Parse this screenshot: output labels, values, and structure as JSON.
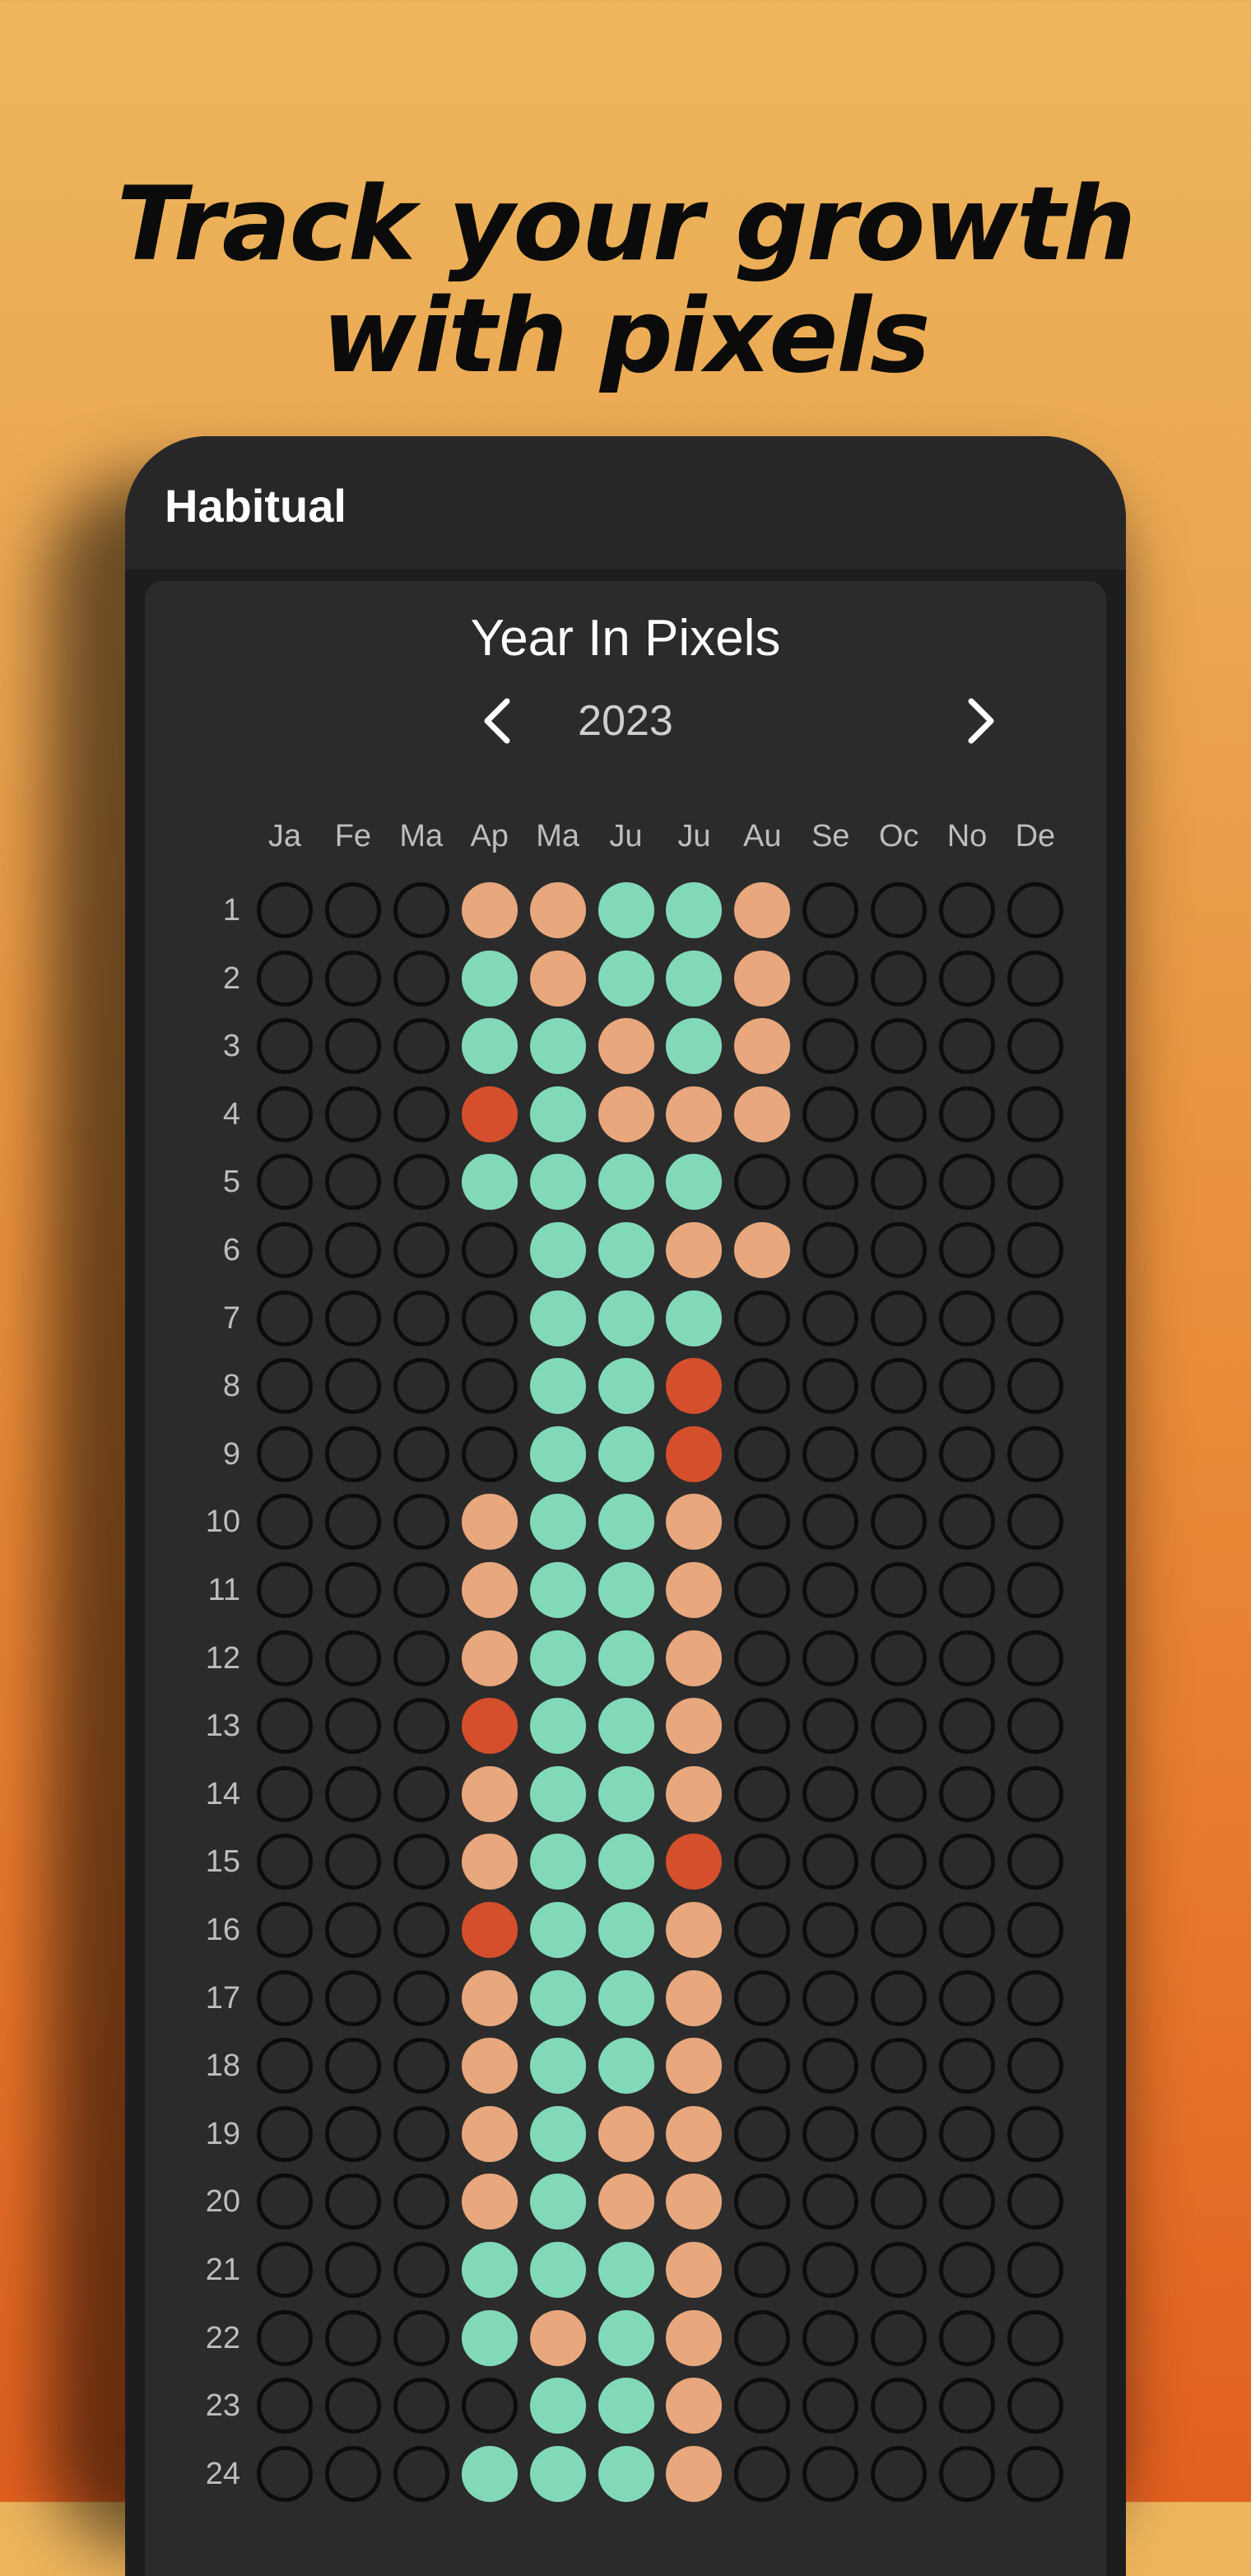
{
  "headline": {
    "line1": "Track your growth",
    "line2": "with pixels"
  },
  "app": {
    "title": "Habitual"
  },
  "year_in_pixels": {
    "title": "Year In Pixels",
    "year": "2023",
    "prev_icon": "chevron-left-icon",
    "next_icon": "chevron-right-icon",
    "months": [
      "Ja",
      "Fe",
      "Ma",
      "Ap",
      "Ma",
      "Ju",
      "Ju",
      "Au",
      "Se",
      "Oc",
      "No",
      "De"
    ],
    "days": [
      "1",
      "2",
      "3",
      "4",
      "5",
      "6",
      "7",
      "8",
      "9",
      "10",
      "11",
      "12",
      "13",
      "14",
      "15",
      "16",
      "17",
      "18",
      "19",
      "20",
      "21",
      "22",
      "23",
      "24"
    ],
    "colors": {
      "P": "#e8a77c",
      "G": "#82d9b8",
      "R": "#d64f2c",
      "E": "transparent",
      "empty_border": "#0c0c0c"
    },
    "rows": [
      "EEEPPGGPEEEE",
      "EEEGPGGPEEEE",
      "EEEGGPGPEEEE",
      "EEERGPPPEEEE",
      "EEEGGGGEEEEE",
      "EEEEGGPPEEEE",
      "EEEEGGGEEEEE",
      "EEEEGGREEEEE",
      "EEEEGGREEEEE",
      "EEEPGGPEEEEE",
      "EEEPGGPEEEEE",
      "EEEPGGPEEEEE",
      "EEERGGPEEEEE",
      "EEEPGGPEEEEE",
      "EEEPGGREEEEE",
      "EEERGGPEEEEE",
      "EEEPGGPEEEEE",
      "EEEPGGPEEEEE",
      "EEEPGPPEEEEE",
      "EEEPGPPEEEEE",
      "EEEGGGPEEEEE",
      "EEEGPGPEEEEE",
      "EEEEGGPEEEEE",
      "EEEGGGPEEEEE"
    ]
  }
}
